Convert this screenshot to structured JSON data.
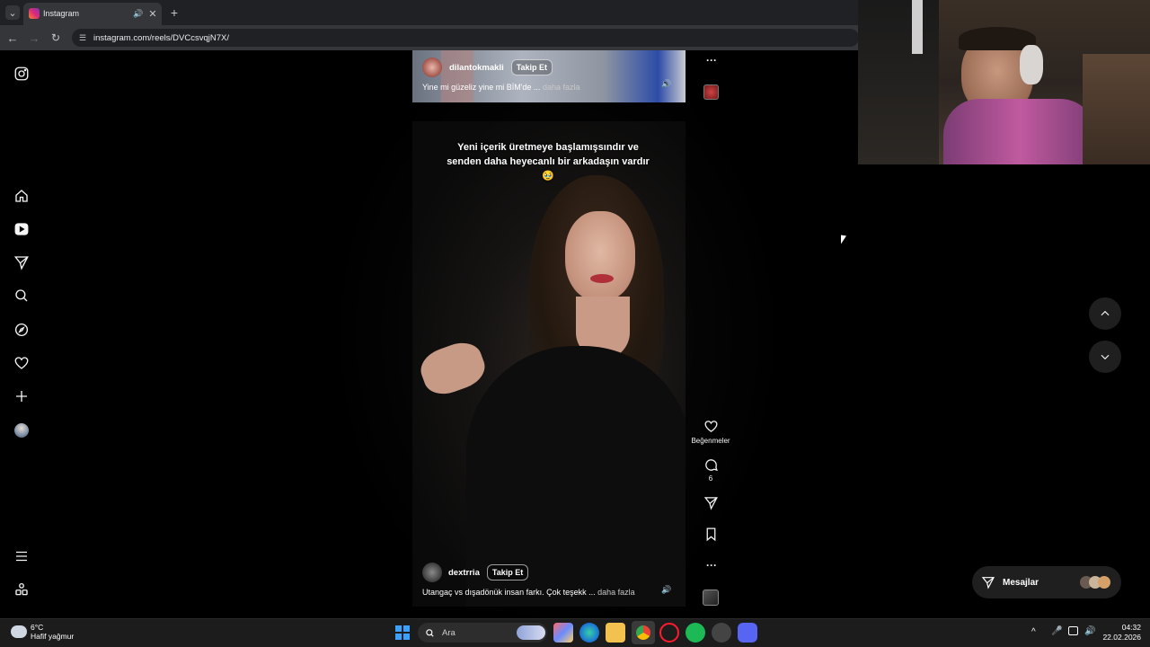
{
  "browser": {
    "tab_title": "Instagram",
    "url": "instagram.com/reels/DVCcsvqjN7X/"
  },
  "reel_top": {
    "username": "dilantokmakli",
    "follow_label": "Takip Et",
    "caption": "Yine mi güzeliz yine mi BİM'de ...",
    "more_label": "daha fazla"
  },
  "reel_main": {
    "overlay_text": "Yeni içerik üretmeye başlamışsındır ve senden daha heyecanlı bir arkadaşın vardır 🥹",
    "username": "dextrria",
    "follow_label": "Takip Et",
    "caption": "Utangaç vs dışadönük insan farkı. Çok teşekk ...",
    "more_label": "daha fazla",
    "likes_label": "Beğenmeler",
    "comments_count": "6"
  },
  "messages": {
    "label": "Mesajlar"
  },
  "taskbar": {
    "weather_temp": "6°C",
    "weather_desc": "Hafif yağmur",
    "search_placeholder": "Ara",
    "time": "04:32",
    "date": "22.02.2026"
  },
  "colors": {
    "background": "#000000",
    "button_bg": "#1f1f1f",
    "chrome_bg": "#202124"
  }
}
